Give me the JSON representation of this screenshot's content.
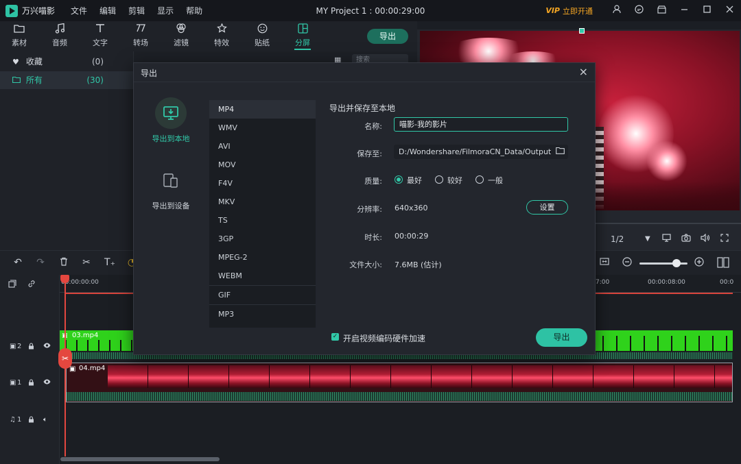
{
  "titlebar": {
    "app_name": "万兴喵影",
    "menu": [
      "文件",
      "编辑",
      "剪辑",
      "显示",
      "帮助"
    ],
    "project_title": "MY Project 1 : 00:00:29:00",
    "vip_badge": "VIP",
    "vip_text": "立即开通",
    "icons": [
      "user-icon",
      "feedback-icon",
      "store-icon",
      "minimize-icon",
      "maximize-icon",
      "close-icon"
    ]
  },
  "tooltabs": [
    {
      "label": "素材",
      "icon": "folder-icon"
    },
    {
      "label": "音频",
      "icon": "music-note-icon"
    },
    {
      "label": "文字",
      "icon": "text-icon"
    },
    {
      "label": "转场",
      "icon": "transition-icon"
    },
    {
      "label": "滤镜",
      "icon": "filter-icon"
    },
    {
      "label": "特效",
      "icon": "effects-icon"
    },
    {
      "label": "贴纸",
      "icon": "sticker-icon"
    },
    {
      "label": "分屏",
      "icon": "split-screen-icon",
      "active": true
    }
  ],
  "top_export_label": "导出",
  "library": {
    "search_placeholder": "搜索",
    "items": [
      {
        "label": "收藏",
        "count": "(0)",
        "icon": "heart-icon"
      },
      {
        "label": "所有",
        "count": "(30)",
        "icon": "folder-icon",
        "selected": true
      }
    ]
  },
  "preview": {
    "page_indicator": "1/2"
  },
  "timeline": {
    "ruler_labels": [
      "00:00:00:00",
      "7:00",
      "00:00:08:00",
      "00:0"
    ],
    "tracks": [
      {
        "id": "track-v2",
        "label": "2",
        "clip_name": "03.mp4"
      },
      {
        "id": "track-v1",
        "label": "1",
        "clip_name": "04.mp4"
      },
      {
        "id": "track-a1",
        "label": "1"
      }
    ]
  },
  "modal": {
    "title": "导出",
    "side_options": [
      {
        "label": "导出到本地",
        "icon": "monitor-download-icon",
        "active": true
      },
      {
        "label": "导出到设备",
        "icon": "devices-icon",
        "active": false
      }
    ],
    "formats": [
      "MP4",
      "WMV",
      "AVI",
      "MOV",
      "F4V",
      "MKV",
      "TS",
      "3GP",
      "MPEG-2",
      "WEBM",
      "GIF",
      "MP3"
    ],
    "selected_format": "MP4",
    "section_title": "导出并保存至本地",
    "fields": {
      "name_label": "名称:",
      "name_value": "喵影-我的影片",
      "save_label": "保存至:",
      "save_path": "D:/Wondershare/FilmoraCN_Data/Output",
      "quality_label": "质量:",
      "quality_options": [
        "最好",
        "较好",
        "一般"
      ],
      "quality_selected": "最好",
      "resolution_label": "分辨率:",
      "resolution_value": "640x360",
      "settings_label": "设置",
      "duration_label": "时长:",
      "duration_value": "00:00:29",
      "filesize_label": "文件大小:",
      "filesize_value": "7.6MB (估计)"
    },
    "hw_accel_label": "开启视频编码硬件加速",
    "hw_accel_checked": true,
    "export_label": "导出"
  }
}
